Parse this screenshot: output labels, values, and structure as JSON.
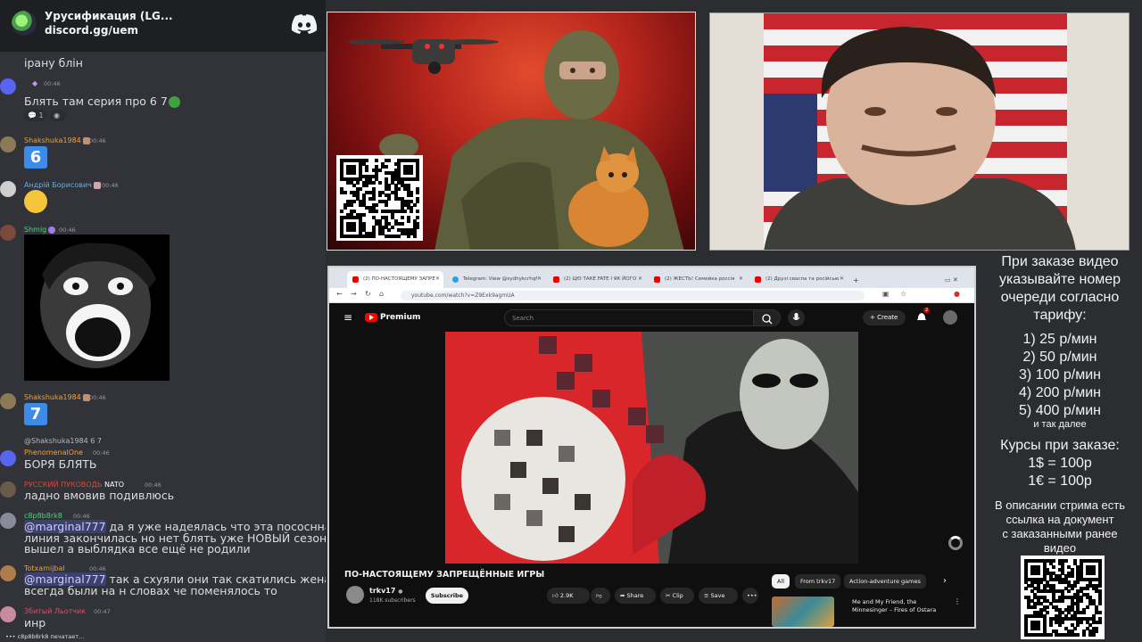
{
  "chat": {
    "server_name": "Урусификация (LG...",
    "server_invite": "discord.gg/uem",
    "messages": [
      {
        "text": "ірану блін"
      },
      {
        "name": "",
        "time": "00:46",
        "text": "Блять там серия про 6 7",
        "reactions": [
          "1",
          ""
        ]
      },
      {
        "name": "Shakshuka1984",
        "time": "00:46",
        "emoji": "6"
      },
      {
        "name": "Андрій Борисович",
        "time": "00:46"
      },
      {
        "name": "Shmig",
        "time": "00:46"
      },
      {
        "name": "Shakshuka1984",
        "time": "00:46",
        "emoji": "7"
      },
      {
        "reply_to": "@Shakshuka1984",
        "reply_text": "6 7",
        "name": "PhenomenalOne",
        "time": "00:46",
        "text": "БОРЯ БЛЯТЬ"
      },
      {
        "name": "РУССКИЙ ПУКОВОДЬ",
        "tag": "NATO",
        "time": "00:46",
        "text": "ладно вмовив подивлюсь"
      },
      {
        "name": "c8p8b8rk8",
        "time": "00:46",
        "mention": "@marginal777",
        "text": " да я уже надеялась что эта пососнная",
        "text2": "линия закончилась но нет блять уже НОВЫЙ сезон",
        "text3": "вышел а выблядка все ещё не родили"
      },
      {
        "name": "Totxamijbal",
        "time": "00:46",
        "mention": "@marginal777",
        "text": " так а схуяли они так скатились женаты",
        "text2": "всегда были на н словах че поменялось то"
      },
      {
        "name": "Збитый Льотчик",
        "time": "00:47",
        "text": "инр"
      }
    ],
    "typing": "c8p8b8rk8 печатает..."
  },
  "browser": {
    "tabs": [
      "(2) ПО-НАСТОЯЩЕМУ ЗАПРЕ",
      "Telegram: View @xydhykcrhqf",
      "(2) ЦЮ ТАКЕ FATE І ЯК ЙОГО",
      "(2) ЖЕСТЬ! Семейка россія",
      "(2) Друзі сваспа та російсью"
    ],
    "url": "youtube.com/watch?v=Z9Exk9agmUA",
    "yt": {
      "premium": "Premium",
      "search_placeholder": "Search",
      "create": "Create",
      "notif_count": "2"
    },
    "video": {
      "title": "ПО-НАСТОЯЩЕМУ ЗАПРЕЩЁННЫЕ ИГРЫ",
      "channel": "trkv17",
      "subs": "118K subscribers",
      "subscribe": "Subscribe",
      "likes": "2.9K",
      "share": "Share",
      "clip": "Clip",
      "save": "Save"
    },
    "chips": [
      "All",
      "From trkv17",
      "Action-adventure games"
    ],
    "rec_title": "Me and My Friend, the Minnesinger – Fires of Ostara"
  },
  "info": {
    "intro": [
      "При заказе видео",
      "указывайте номер",
      "очереди согласно",
      "тарифу:"
    ],
    "rates": [
      "1) 25 р/мин",
      "2) 50 р/мин",
      "3) 100 р/мин",
      "4) 200 р/мин",
      "5) 400 р/мин"
    ],
    "rates_more": "и так далее",
    "courses_title": "Курсы при заказе:",
    "courses": [
      "1$ = 100р",
      "1€ = 100р"
    ],
    "desc": [
      "В описании стрима есть",
      "ссылка на документ",
      "с заказанными ранее",
      "видео"
    ]
  }
}
